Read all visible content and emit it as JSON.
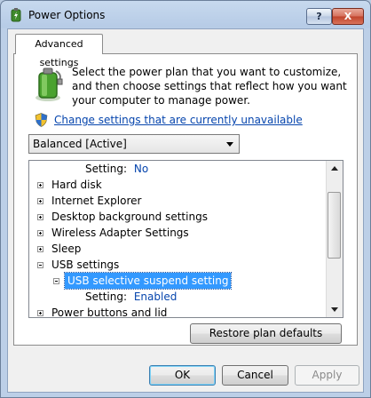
{
  "window": {
    "title": "Power Options"
  },
  "titlebar": {
    "help_label": "?",
    "close_label": "X"
  },
  "tabs": [
    {
      "label": "Advanced settings"
    }
  ],
  "intro_text": "Select the power plan that you want to customize, and then choose settings that reflect how you want your computer to manage power.",
  "change_link": "Change settings that are currently unavailable",
  "plan_select": {
    "value": "Balanced [Active]"
  },
  "tree": {
    "items": [
      {
        "label": "Setting:",
        "value": "No"
      },
      {
        "label": "Hard disk",
        "state": "collapsed"
      },
      {
        "label": "Internet Explorer",
        "state": "collapsed"
      },
      {
        "label": "Desktop background settings",
        "state": "collapsed"
      },
      {
        "label": "Wireless Adapter Settings",
        "state": "collapsed"
      },
      {
        "label": "Sleep",
        "state": "collapsed"
      },
      {
        "label": "USB settings",
        "state": "expanded"
      },
      {
        "label": "USB selective suspend setting",
        "state": "expanded",
        "selected": true
      },
      {
        "label": "Setting:",
        "value": "Enabled"
      },
      {
        "label": "Power buttons and lid",
        "state": "collapsed"
      }
    ]
  },
  "buttons": {
    "restore": "Restore plan defaults",
    "ok": "OK",
    "cancel": "Cancel",
    "apply": "Apply"
  },
  "colors": {
    "selection": "#3399ff",
    "link": "#0645ad",
    "value_text": "#0645ad"
  }
}
